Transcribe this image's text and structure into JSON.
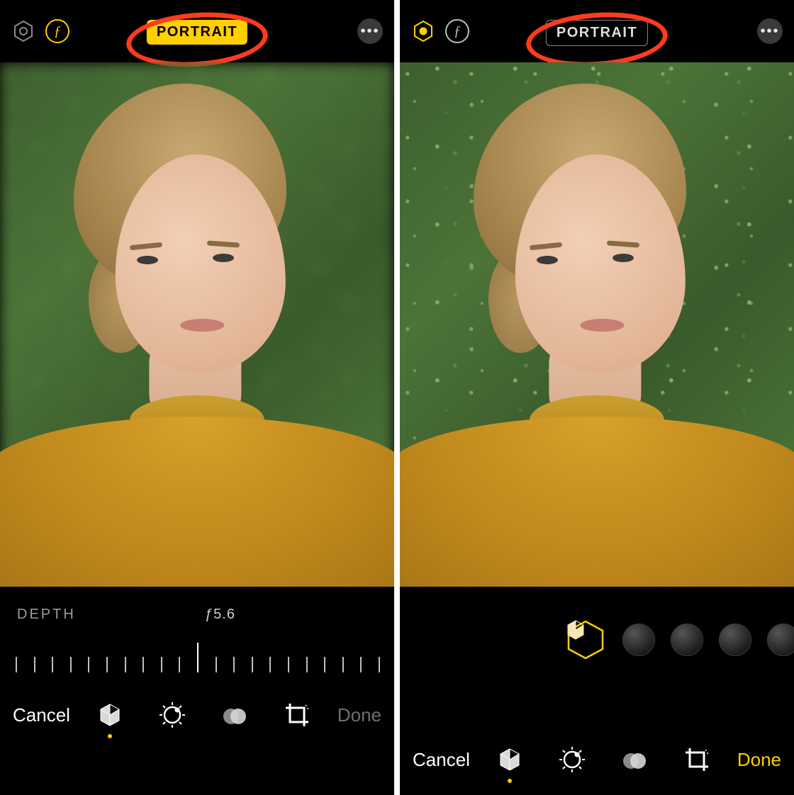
{
  "left": {
    "top": {
      "mode_label": "PORTRAIT",
      "mode_active": true,
      "lighting_icon": "hexagon-lighting-icon",
      "aperture_icon_label": "ƒ",
      "aperture_active": true,
      "more_label": "•••"
    },
    "depth": {
      "label": "DEPTH",
      "value": "ƒ5.6",
      "tick_count": 21,
      "current_index": 10
    },
    "toolbar": {
      "cancel": "Cancel",
      "done": "Done",
      "done_style": "dim",
      "selected_tab_index": 0,
      "tabs": [
        "portrait-cube-icon",
        "adjust-dial-icon",
        "filters-icon",
        "crop-icon"
      ]
    }
  },
  "right": {
    "top": {
      "mode_label": "PORTRAIT",
      "mode_active": false,
      "lighting_icon": "hexagon-lighting-icon",
      "aperture_icon_label": "ƒ",
      "aperture_active": false,
      "more_label": "•••"
    },
    "lighting_picker": {
      "selected_index": 0,
      "item_count": 5
    },
    "toolbar": {
      "cancel": "Cancel",
      "done": "Done",
      "done_style": "yellow",
      "selected_tab_index": 0,
      "tabs": [
        "portrait-cube-icon",
        "adjust-dial-icon",
        "filters-icon",
        "crop-icon"
      ]
    }
  },
  "colors": {
    "accent": "#ffcf00",
    "annotation": "#ff3b1f"
  }
}
